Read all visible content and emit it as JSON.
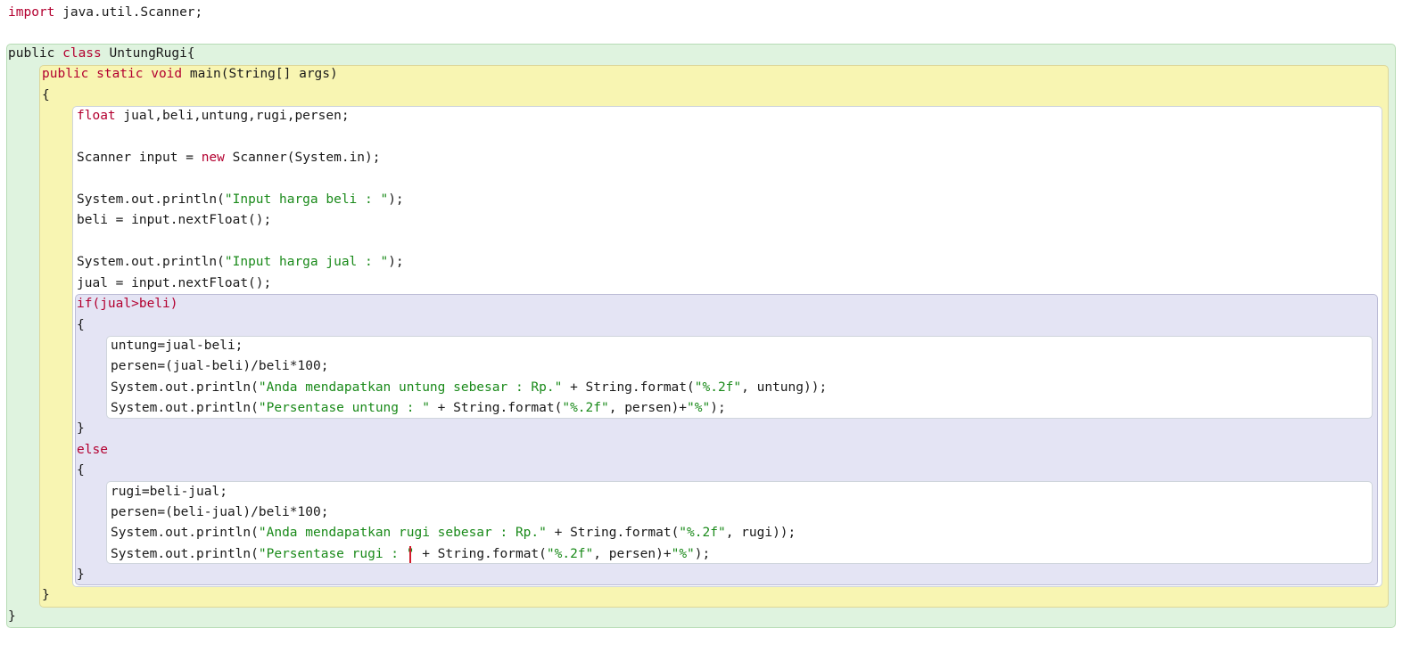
{
  "editor": {
    "colors": {
      "keyword": "#b30030",
      "string": "#1a8a1a",
      "text": "#1a1a1a",
      "class_block_bg": "#dff3df",
      "method_block_bg": "#f8f5b2",
      "if_block_bg": "#e4e4f4",
      "inner_block_bg": "#ffffff",
      "caret": "#d01c2c"
    },
    "lines": [
      {
        "tokens": [
          {
            "t": "import",
            "c": "kw"
          },
          {
            "t": " java.util.Scanner;",
            "c": "txt"
          }
        ]
      },
      {
        "tokens": [
          {
            "t": "public ",
            "c": "txt"
          },
          {
            "t": "class",
            "c": "kw"
          },
          {
            "t": " UntungRugi{",
            "c": "txt"
          }
        ]
      },
      {
        "tokens": [
          {
            "t": "public static ",
            "c": "kw"
          },
          {
            "t": "void",
            "c": "kw"
          },
          {
            "t": " main(String[] args)",
            "c": "txt"
          }
        ]
      },
      {
        "tokens": [
          {
            "t": "{",
            "c": "txt"
          }
        ]
      },
      {
        "tokens": [
          {
            "t": "float",
            "c": "kw"
          },
          {
            "t": " jual,beli,untung,rugi,persen;",
            "c": "txt"
          }
        ]
      },
      {
        "tokens": [
          {
            "t": "Scanner input = ",
            "c": "txt"
          },
          {
            "t": "new",
            "c": "kw"
          },
          {
            "t": " Scanner(System.in);",
            "c": "txt"
          }
        ]
      },
      {
        "tokens": [
          {
            "t": "System.out.println(",
            "c": "txt"
          },
          {
            "t": "\"Input harga beli : \"",
            "c": "str"
          },
          {
            "t": ");",
            "c": "txt"
          }
        ]
      },
      {
        "tokens": [
          {
            "t": "beli = input.nextFloat();",
            "c": "txt"
          }
        ]
      },
      {
        "tokens": [
          {
            "t": "System.out.println(",
            "c": "txt"
          },
          {
            "t": "\"Input harga jual : \"",
            "c": "str"
          },
          {
            "t": ");",
            "c": "txt"
          }
        ]
      },
      {
        "tokens": [
          {
            "t": "jual = input.nextFloat();",
            "c": "txt"
          }
        ]
      },
      {
        "tokens": [
          {
            "t": "if(jual>beli)",
            "c": "kw"
          }
        ]
      },
      {
        "tokens": [
          {
            "t": "{",
            "c": "txt"
          }
        ]
      },
      {
        "tokens": [
          {
            "t": "untung=jual-beli;",
            "c": "txt"
          }
        ]
      },
      {
        "tokens": [
          {
            "t": "persen=(jual-beli)/beli*100;",
            "c": "txt"
          }
        ]
      },
      {
        "tokens": [
          {
            "t": "System.out.println(",
            "c": "txt"
          },
          {
            "t": "\"Anda mendapatkan untung sebesar : Rp.\"",
            "c": "str"
          },
          {
            "t": " + String.format(",
            "c": "txt"
          },
          {
            "t": "\"%.2f\"",
            "c": "str"
          },
          {
            "t": ", untung));",
            "c": "txt"
          }
        ]
      },
      {
        "tokens": [
          {
            "t": "System.out.println(",
            "c": "txt"
          },
          {
            "t": "\"Persentase untung : \"",
            "c": "str"
          },
          {
            "t": " + String.format(",
            "c": "txt"
          },
          {
            "t": "\"%.2f\"",
            "c": "str"
          },
          {
            "t": ", persen)+",
            "c": "txt"
          },
          {
            "t": "\"%\"",
            "c": "str"
          },
          {
            "t": ");",
            "c": "txt"
          }
        ]
      },
      {
        "tokens": [
          {
            "t": "}",
            "c": "txt"
          }
        ]
      },
      {
        "tokens": [
          {
            "t": "else",
            "c": "kw"
          }
        ]
      },
      {
        "tokens": [
          {
            "t": "{",
            "c": "txt"
          }
        ]
      },
      {
        "tokens": [
          {
            "t": "rugi=beli-jual;",
            "c": "txt"
          }
        ]
      },
      {
        "tokens": [
          {
            "t": "persen=(beli-jual)/beli*100;",
            "c": "txt"
          }
        ]
      },
      {
        "tokens": [
          {
            "t": "System.out.println(",
            "c": "txt"
          },
          {
            "t": "\"Anda mendapatkan rugi sebesar : Rp.\"",
            "c": "str"
          },
          {
            "t": " + String.format(",
            "c": "txt"
          },
          {
            "t": "\"%.2f\"",
            "c": "str"
          },
          {
            "t": ", rugi));",
            "c": "txt"
          }
        ]
      },
      {
        "tokens": [
          {
            "t": "System.out.println(",
            "c": "txt"
          },
          {
            "t": "\"Persentase rugi : \"",
            "c": "str"
          },
          {
            "t": " + String.format(",
            "c": "txt"
          },
          {
            "t": "\"%.2f\"",
            "c": "str"
          },
          {
            "t": ", persen)+",
            "c": "txt"
          },
          {
            "t": "\"%\"",
            "c": "str"
          },
          {
            "t": ");",
            "c": "txt"
          }
        ]
      },
      {
        "tokens": [
          {
            "t": "}",
            "c": "txt"
          }
        ]
      },
      {
        "tokens": [
          {
            "t": "}",
            "c": "txt"
          }
        ]
      },
      {
        "tokens": [
          {
            "t": "}",
            "c": "txt"
          }
        ]
      }
    ]
  }
}
